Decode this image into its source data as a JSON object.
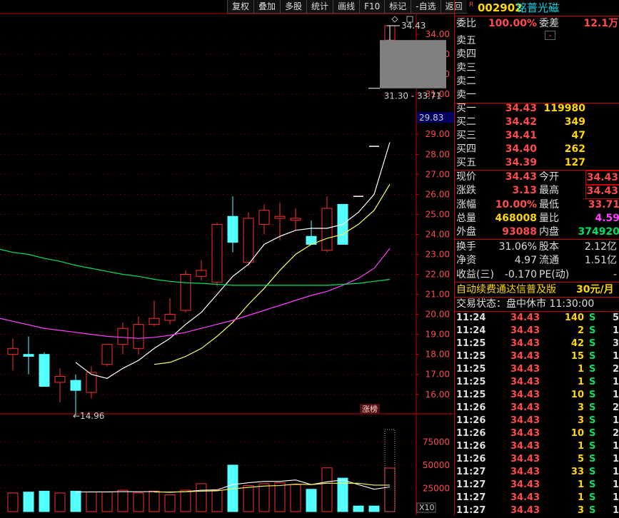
{
  "toolbar": [
    "复权",
    "叠加",
    "多股",
    "统计",
    "画线",
    "F10",
    "标记",
    "-自选",
    "返回"
  ],
  "header": {
    "badge": "R",
    "code": "002902",
    "name": "铭普光磁"
  },
  "order_ratio": {
    "label1": "委比",
    "value1": "100.00%",
    "label2": "委差",
    "value2": "12.1万"
  },
  "asks": [
    {
      "label": "卖五",
      "price": "",
      "vol": ""
    },
    {
      "label": "卖四",
      "price": "",
      "vol": ""
    },
    {
      "label": "卖三",
      "price": "",
      "vol": ""
    },
    {
      "label": "卖二",
      "price": "",
      "vol": ""
    },
    {
      "label": "卖一",
      "price": "",
      "vol": ""
    }
  ],
  "bids": [
    {
      "label": "买一",
      "price": "34.43",
      "vol": "119980"
    },
    {
      "label": "买二",
      "price": "34.42",
      "vol": "349"
    },
    {
      "label": "买三",
      "price": "34.41",
      "vol": "47"
    },
    {
      "label": "买四",
      "price": "34.40",
      "vol": "262"
    },
    {
      "label": "买五",
      "price": "34.39",
      "vol": "127"
    }
  ],
  "quote": [
    {
      "l1": "现价",
      "v1": "34.43",
      "c1": "red",
      "l2": "今开",
      "v2": "34.43",
      "c2": "red",
      "box2": true
    },
    {
      "l1": "涨跌",
      "v1": "3.13",
      "c1": "red",
      "l2": "最高",
      "v2": "34.43",
      "c2": "red",
      "box2": true
    },
    {
      "l1": "涨幅",
      "v1": "10.00%",
      "c1": "red",
      "l2": "最低",
      "v2": "33.71",
      "c2": "red",
      "box2": false
    },
    {
      "l1": "总量",
      "v1": "468008",
      "c1": "yel",
      "l2": "量比",
      "v2": "4.59",
      "c2": "mag",
      "box2": false
    },
    {
      "l1": "外盘",
      "v1": "93088",
      "c1": "red",
      "l2": "内盘",
      "v2": "374920",
      "c2": "grn",
      "box2": false
    }
  ],
  "fundamentals": [
    {
      "l1": "换手",
      "v1": "31.06%",
      "l2": "股本",
      "v2": "2.12亿"
    },
    {
      "l1": "净资",
      "v1": "4.97",
      "l2": "流通",
      "v2": "1.51亿"
    },
    {
      "l1": "收益(三)",
      "v1": "-0.170",
      "l2": "PE(动)",
      "v2": "-"
    }
  ],
  "ad_text": "自动续费通达信普及版",
  "ad_price": "30元/月",
  "trade_status": "交易状态：盘中休市 11:30:00",
  "trades": [
    {
      "t": "11:24",
      "p": "34.43",
      "v": "140",
      "s": "S",
      "n": "5"
    },
    {
      "t": "11:24",
      "p": "34.43",
      "v": "2",
      "s": "S",
      "n": "1"
    },
    {
      "t": "11:25",
      "p": "34.43",
      "v": "42",
      "s": "S",
      "n": "3"
    },
    {
      "t": "11:25",
      "p": "34.43",
      "v": "15",
      "s": "S",
      "n": "1"
    },
    {
      "t": "11:25",
      "p": "34.43",
      "v": "1",
      "s": "S",
      "n": "2"
    },
    {
      "t": "11:25",
      "p": "34.43",
      "v": "1",
      "s": "S",
      "n": "1"
    },
    {
      "t": "11:25",
      "p": "34.43",
      "v": "10",
      "s": "S",
      "n": "1"
    },
    {
      "t": "11:26",
      "p": "34.43",
      "v": "3",
      "s": "S",
      "n": "2"
    },
    {
      "t": "11:26",
      "p": "34.43",
      "v": "3",
      "s": "S",
      "n": "1"
    },
    {
      "t": "11:26",
      "p": "34.43",
      "v": "10",
      "s": "S",
      "n": "2"
    },
    {
      "t": "11:26",
      "p": "34.43",
      "v": "1",
      "s": "S",
      "n": "1"
    },
    {
      "t": "11:26",
      "p": "34.43",
      "v": "5",
      "s": "S",
      "n": "1"
    },
    {
      "t": "11:27",
      "p": "34.43",
      "v": "33",
      "s": "S",
      "n": "1"
    },
    {
      "t": "11:27",
      "p": "34.43",
      "v": "1",
      "s": "S",
      "n": "1"
    },
    {
      "t": "11:27",
      "p": "34.43",
      "v": "1",
      "s": "S",
      "n": "1"
    },
    {
      "t": "11:27",
      "p": "34.43",
      "v": "3",
      "s": "S",
      "n": "1"
    }
  ],
  "chart_data": {
    "type": "candlestick",
    "price_axis": {
      "ticks": [
        16,
        17,
        18,
        19,
        20,
        21,
        22,
        23,
        24,
        25,
        26,
        27,
        28,
        29,
        31,
        32,
        33,
        34
      ],
      "ylim": [
        15.1,
        35.0
      ]
    },
    "current_price_marker": "29.83",
    "labels": {
      "high_label": "34.43",
      "low_label": "14.96",
      "range_label": "31.30 - 33.71",
      "limit_up_tag": "涨榜",
      "vol_unit": "X10"
    },
    "candles": [
      {
        "o": 18.0,
        "h": 18.8,
        "l": 17.2,
        "c": 18.3
      },
      {
        "o": 18.0,
        "h": 18.9,
        "l": 17.0,
        "c": 17.9
      },
      {
        "o": 18.0,
        "h": 18.1,
        "l": 16.6,
        "c": 16.4
      },
      {
        "o": 16.6,
        "h": 17.3,
        "l": 15.6,
        "c": 16.9
      },
      {
        "o": 16.7,
        "h": 17.0,
        "l": 14.96,
        "c": 16.2
      },
      {
        "o": 16.1,
        "h": 17.4,
        "l": 15.8,
        "c": 17.1
      },
      {
        "o": 17.5,
        "h": 18.5,
        "l": 17.4,
        "c": 18.5
      },
      {
        "o": 18.5,
        "h": 19.6,
        "l": 18.0,
        "c": 19.3
      },
      {
        "o": 18.3,
        "h": 19.9,
        "l": 18.0,
        "c": 19.5
      },
      {
        "o": 19.5,
        "h": 20.7,
        "l": 19.4,
        "c": 19.8
      },
      {
        "o": 19.7,
        "h": 20.8,
        "l": 19.5,
        "c": 20.0
      },
      {
        "o": 20.2,
        "h": 22.2,
        "l": 20.1,
        "c": 22.0
      },
      {
        "o": 21.9,
        "h": 22.7,
        "l": 21.7,
        "c": 22.2
      },
      {
        "o": 21.6,
        "h": 24.6,
        "l": 21.4,
        "c": 24.5
      },
      {
        "o": 24.9,
        "h": 25.9,
        "l": 23.1,
        "c": 23.6
      },
      {
        "o": 22.6,
        "h": 25.1,
        "l": 22.4,
        "c": 24.8
      },
      {
        "o": 24.5,
        "h": 25.5,
        "l": 24.0,
        "c": 25.2
      },
      {
        "o": 24.8,
        "h": 25.6,
        "l": 23.7,
        "c": 24.9
      },
      {
        "o": 24.7,
        "h": 25.3,
        "l": 24.2,
        "c": 24.8
      },
      {
        "o": 23.9,
        "h": 24.7,
        "l": 23.6,
        "c": 23.5
      },
      {
        "o": 23.2,
        "h": 25.9,
        "l": 23.1,
        "c": 25.3
      },
      {
        "o": 25.5,
        "h": 25.5,
        "l": 23.6,
        "c": 23.5
      },
      {
        "o": 26.0,
        "h": 26.0,
        "l": 25.9,
        "c": 25.9
      },
      {
        "o": 28.5,
        "h": 28.5,
        "l": 28.4,
        "c": 28.4
      },
      {
        "o": 33.71,
        "h": 34.43,
        "l": 31.3,
        "c": 34.43
      }
    ],
    "ma": [
      {
        "color": "#ffffff",
        "values": [
          null,
          null,
          null,
          null,
          17.6,
          17.0,
          16.8,
          17.3,
          17.7,
          18.3,
          18.8,
          19.5,
          20.1,
          21.0,
          21.9,
          22.5,
          23.5,
          23.9,
          24.2,
          24.3,
          24.3,
          24.5,
          25.1,
          26.0,
          28.6
        ]
      },
      {
        "color": "#ffff60",
        "values": [
          null,
          null,
          null,
          null,
          null,
          null,
          null,
          null,
          null,
          17.5,
          17.6,
          17.9,
          18.3,
          18.9,
          19.6,
          20.5,
          21.3,
          22.2,
          23.0,
          23.5,
          23.8,
          24.0,
          24.5,
          25.2,
          26.5
        ]
      },
      {
        "color": "#ff40ff",
        "values": [
          null,
          null,
          19.3,
          19.2,
          19.1,
          19.0,
          18.9,
          18.85,
          18.8,
          18.85,
          18.95,
          19.1,
          19.3,
          19.5,
          19.7,
          19.95,
          20.2,
          20.45,
          20.7,
          20.95,
          21.15,
          21.45,
          21.8,
          22.3,
          23.3
        ]
      },
      {
        "color": "#00e060",
        "values": [
          23.1,
          23.0,
          22.8,
          22.65,
          22.45,
          22.3,
          22.15,
          22.0,
          21.9,
          21.75,
          21.65,
          21.58,
          21.55,
          21.5,
          21.45,
          21.45,
          21.45,
          21.45,
          21.45,
          21.45,
          21.45,
          21.5,
          21.55,
          21.65,
          21.75
        ]
      }
    ],
    "volume_axis": {
      "ticks": [
        25000,
        50000,
        75000
      ],
      "ylim": [
        0,
        99000
      ]
    },
    "volumes": [
      20000,
      21000,
      22000,
      20000,
      22000,
      21000,
      21000,
      23000,
      20000,
      22000,
      18000,
      23000,
      30000,
      23000,
      50000,
      28000,
      30000,
      31000,
      29000,
      24000,
      47000,
      36000,
      6000,
      6000,
      46800
    ],
    "volume_ma": [
      {
        "color": "#ffffff",
        "values": [
          null,
          null,
          null,
          null,
          21000,
          21200,
          21200,
          21400,
          21300,
          21500,
          20700,
          21500,
          23000,
          23300,
          29000,
          31000,
          32500,
          32500,
          34000,
          29000,
          32000,
          34000,
          29000,
          24000,
          26500
        ]
      },
      {
        "color": "#ffff60",
        "values": [
          null,
          null,
          null,
          null,
          null,
          null,
          null,
          null,
          null,
          21000,
          21000,
          21300,
          22000,
          22300,
          24500,
          26000,
          27500,
          28000,
          29500,
          29000,
          30500,
          30500,
          30500,
          28500,
          28500
        ]
      }
    ]
  }
}
